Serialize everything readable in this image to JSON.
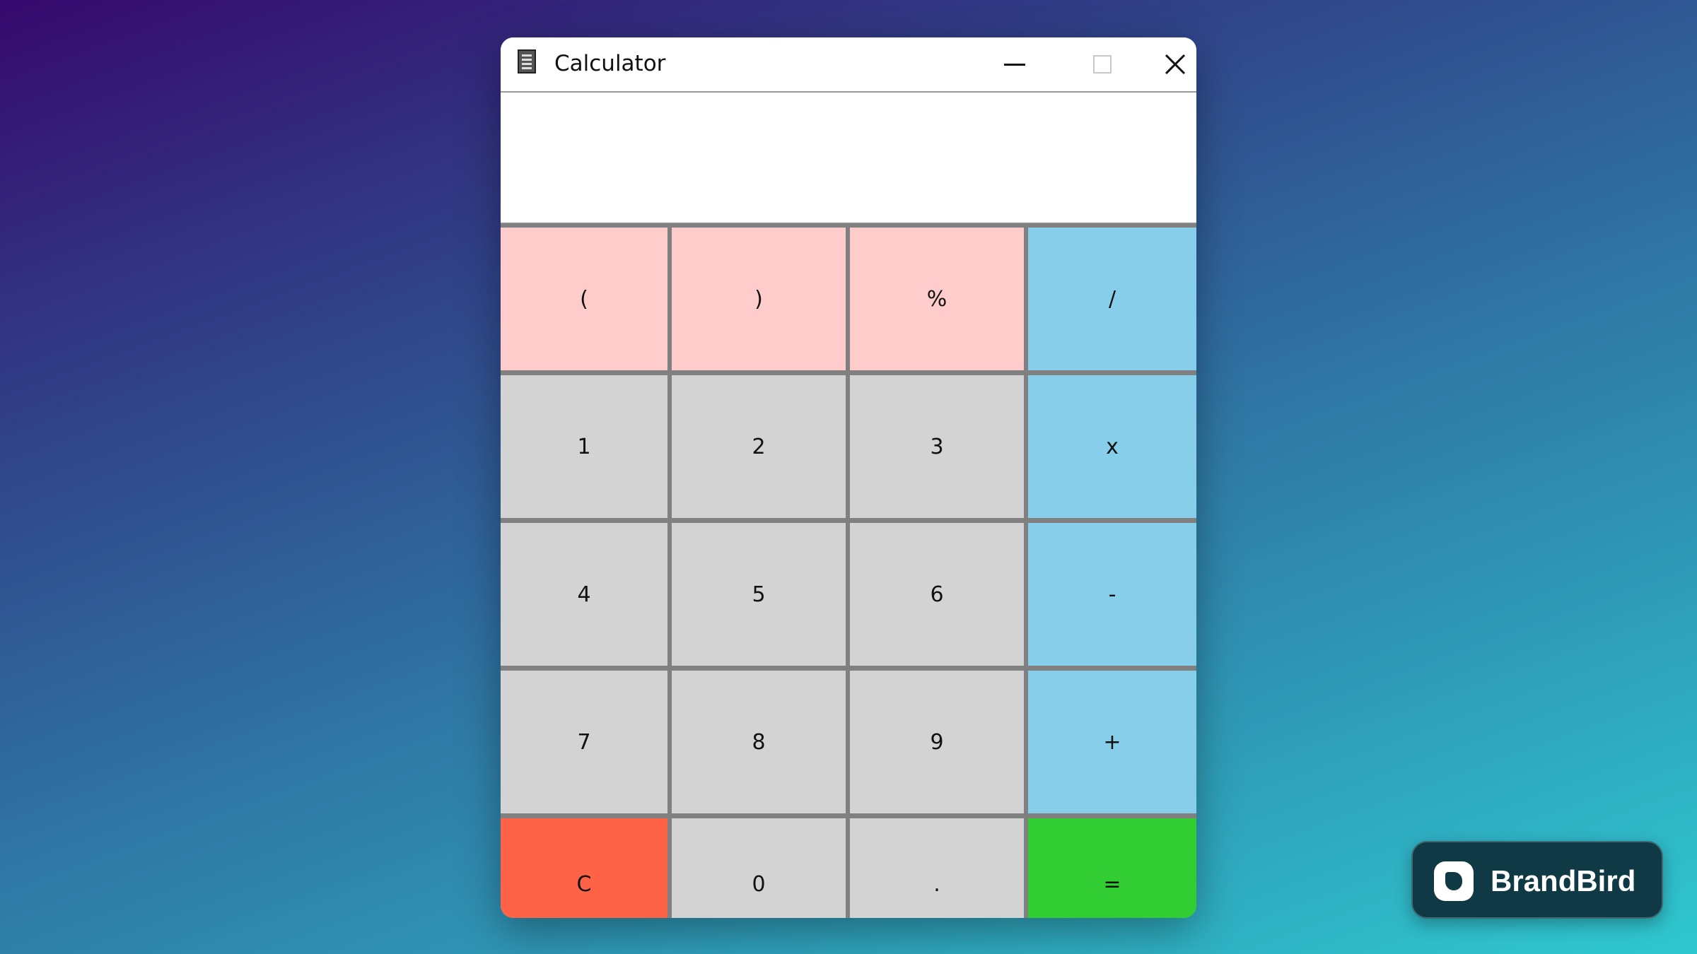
{
  "window": {
    "title": "Calculator",
    "icon": "calculator-icon",
    "controls": {
      "minimize": "minimize-icon",
      "maximize": "maximize-icon",
      "close": "close-icon"
    }
  },
  "display": {
    "value": ""
  },
  "colors": {
    "paren_keys": "#ffcccc",
    "operator_keys": "#87ceeb",
    "digit_keys": "#d3d3d3",
    "clear_key": "#ff6347",
    "equals_key": "#32cd32",
    "key_gap": "#808080"
  },
  "keys": [
    {
      "label": "(",
      "name": "open-paren-button",
      "color": "#ffcccc"
    },
    {
      "label": ")",
      "name": "close-paren-button",
      "color": "#ffcccc"
    },
    {
      "label": "%",
      "name": "percent-button",
      "color": "#ffcccc"
    },
    {
      "label": "/",
      "name": "divide-button",
      "color": "#87ceeb"
    },
    {
      "label": "1",
      "name": "digit-1-button",
      "color": "#d3d3d3"
    },
    {
      "label": "2",
      "name": "digit-2-button",
      "color": "#d3d3d3"
    },
    {
      "label": "3",
      "name": "digit-3-button",
      "color": "#d3d3d3"
    },
    {
      "label": "x",
      "name": "multiply-button",
      "color": "#87ceeb"
    },
    {
      "label": "4",
      "name": "digit-4-button",
      "color": "#d3d3d3"
    },
    {
      "label": "5",
      "name": "digit-5-button",
      "color": "#d3d3d3"
    },
    {
      "label": "6",
      "name": "digit-6-button",
      "color": "#d3d3d3"
    },
    {
      "label": "-",
      "name": "subtract-button",
      "color": "#87ceeb"
    },
    {
      "label": "7",
      "name": "digit-7-button",
      "color": "#d3d3d3"
    },
    {
      "label": "8",
      "name": "digit-8-button",
      "color": "#d3d3d3"
    },
    {
      "label": "9",
      "name": "digit-9-button",
      "color": "#d3d3d3"
    },
    {
      "label": "+",
      "name": "add-button",
      "color": "#87ceeb"
    },
    {
      "label": "C",
      "name": "clear-button",
      "color": "#ff6347"
    },
    {
      "label": "0",
      "name": "digit-0-button",
      "color": "#d3d3d3"
    },
    {
      "label": ".",
      "name": "decimal-point-button",
      "color": "#d3d3d3"
    },
    {
      "label": "=",
      "name": "equals-button",
      "color": "#32cd32"
    }
  ],
  "watermark": {
    "text": "BrandBird",
    "icon": "brandbird-logo-icon"
  }
}
